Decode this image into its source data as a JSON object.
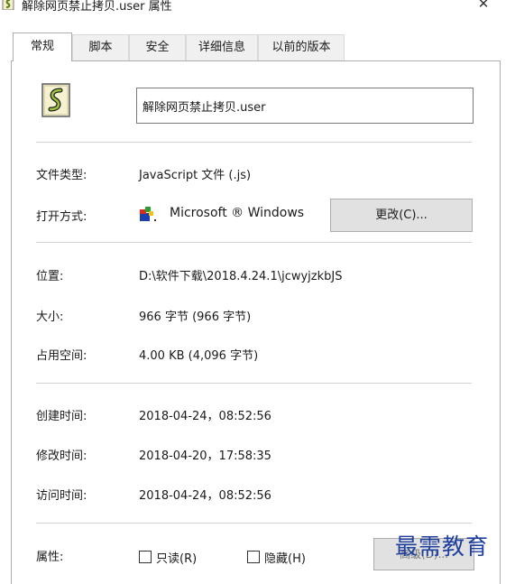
{
  "window": {
    "title": "解除网页禁止拷贝.user 属性",
    "close_glyph": "✕"
  },
  "tabs": [
    {
      "label": "常规",
      "active": true
    },
    {
      "label": "脚本",
      "active": false
    },
    {
      "label": "安全",
      "active": false
    },
    {
      "label": "详细信息",
      "active": false
    },
    {
      "label": "以前的版本",
      "active": false
    }
  ],
  "general": {
    "file_name": "解除网页禁止拷贝.user",
    "file_type_label": "文件类型:",
    "file_type_value": "JavaScript 文件 (.js)",
    "open_with_label": "打开方式:",
    "open_with_app": "Microsoft ® Windows",
    "change_button": "更改(C)...",
    "location_label": "位置:",
    "location_value": "D:\\软件下载\\2018.4.24.1\\jcwyjzkbJS",
    "size_label": "大小:",
    "size_value": "966 字节 (966 字节)",
    "size_on_disk_label": "占用空间:",
    "size_on_disk_value": "4.00 KB (4,096 字节)",
    "created_label": "创建时间:",
    "created_value": "2018-04-24，08:52:56",
    "modified_label": "修改时间:",
    "modified_value": "2018-04-20，17:58:35",
    "accessed_label": "访问时间:",
    "accessed_value": "2018-04-24，08:52:56",
    "attributes_label": "属性:",
    "readonly_label": "只读(R)",
    "readonly_checked": false,
    "hidden_label": "隐藏(H)",
    "hidden_checked": false,
    "advanced_button": "高级(D)..."
  },
  "watermark": {
    "text": "最需教育",
    "color": "#1f3f9e"
  },
  "icons": {
    "title": "script-file-icon",
    "file": "script-file-icon",
    "app": "windows-script-host-icon"
  }
}
